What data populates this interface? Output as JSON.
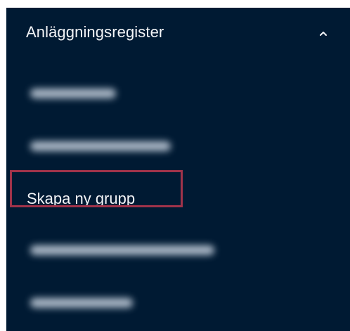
{
  "sidebar": {
    "section": {
      "title": "Anläggningsregister",
      "expanded": true
    },
    "items": [
      {
        "label": "",
        "blurred": true
      },
      {
        "label": "",
        "blurred": true
      },
      {
        "label": "Skapa ny grupp",
        "blurred": false,
        "highlighted": true
      },
      {
        "label": "",
        "blurred": true
      },
      {
        "label": "",
        "blurred": true
      }
    ]
  },
  "colors": {
    "background": "#001a33",
    "text": "#f2f4f7",
    "highlight_border": "#a0334a"
  }
}
